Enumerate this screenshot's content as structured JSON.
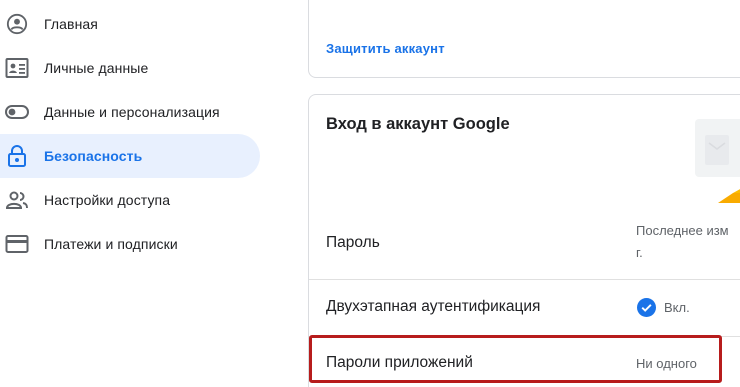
{
  "sidebar": {
    "items": [
      {
        "label": "Главная",
        "icon": "account-circle-icon"
      },
      {
        "label": "Личные данные",
        "icon": "id-card-icon"
      },
      {
        "label": "Данные и персонализация",
        "icon": "toggle-icon"
      },
      {
        "label": "Безопасность",
        "icon": "lock-icon",
        "active": true
      },
      {
        "label": "Настройки доступа",
        "icon": "people-icon"
      },
      {
        "label": "Платежи и подписки",
        "icon": "credit-card-icon"
      }
    ]
  },
  "top_card": {
    "link": "Защитить аккаунт"
  },
  "signin_card": {
    "title": "Вход в аккаунт Google",
    "rows": [
      {
        "label": "Пароль",
        "value_line1": "Последнее изм",
        "value_line2": "г."
      },
      {
        "label": "Двухэтапная аутентификация",
        "value": "Вкл."
      },
      {
        "label": "Пароли приложений",
        "value": "Ни одного"
      }
    ]
  },
  "colors": {
    "accent": "#1a73e8",
    "active_nav_bg": "#e8f0fe",
    "highlight_frame": "#b71c1c",
    "illustration_yellow": "#f9ab00"
  }
}
